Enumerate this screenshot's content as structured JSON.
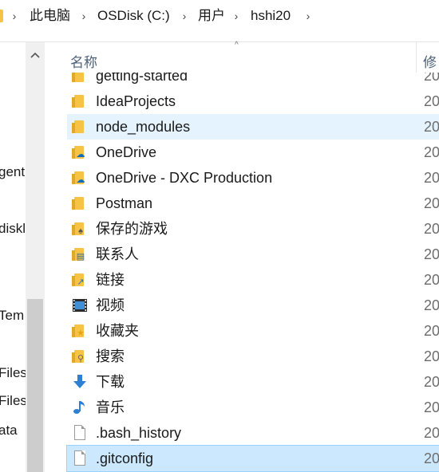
{
  "address_bar": {
    "crumbs": [
      "此电脑",
      "OSDisk (C:)",
      "用户",
      "hshi20"
    ],
    "separator": "›"
  },
  "nav_pane": {
    "partial_labels": [
      "gent",
      "diskl",
      "Tem",
      "Files",
      "Files",
      "ata"
    ]
  },
  "columns": {
    "name": "名称",
    "modified": "修",
    "sort_indicator": "^"
  },
  "files": [
    {
      "name": "getting-started",
      "icon": "folder-icon",
      "date": "20"
    },
    {
      "name": "IdeaProjects",
      "icon": "folder-icon",
      "date": "20"
    },
    {
      "name": "node_modules",
      "icon": "folder-icon",
      "date": "20",
      "state": "hover"
    },
    {
      "name": "OneDrive",
      "icon": "onedrive-folder-icon",
      "date": "20"
    },
    {
      "name": "OneDrive - DXC Production",
      "icon": "onedrive-folder-icon",
      "date": "20"
    },
    {
      "name": "Postman",
      "icon": "folder-icon",
      "date": "20"
    },
    {
      "name": "保存的游戏",
      "icon": "saved-games-folder-icon",
      "date": "20"
    },
    {
      "name": "联系人",
      "icon": "contacts-folder-icon",
      "date": "20"
    },
    {
      "name": "链接",
      "icon": "links-folder-icon",
      "date": "20"
    },
    {
      "name": "视频",
      "icon": "videos-folder-icon",
      "date": "20"
    },
    {
      "name": "收藏夹",
      "icon": "favorites-folder-icon",
      "date": "20"
    },
    {
      "name": "搜索",
      "icon": "searches-folder-icon",
      "date": "20"
    },
    {
      "name": "下载",
      "icon": "downloads-folder-icon",
      "date": "20"
    },
    {
      "name": "音乐",
      "icon": "music-folder-icon",
      "date": "20"
    },
    {
      "name": ".bash_history",
      "icon": "file-icon",
      "date": "20"
    },
    {
      "name": ".gitconfig",
      "icon": "file-icon",
      "date": "20",
      "state": "selected"
    }
  ],
  "colors": {
    "folder": "#f6c344",
    "hover": "#e5f3ff",
    "selected": "#cce8ff",
    "header_text": "#4c607a"
  }
}
